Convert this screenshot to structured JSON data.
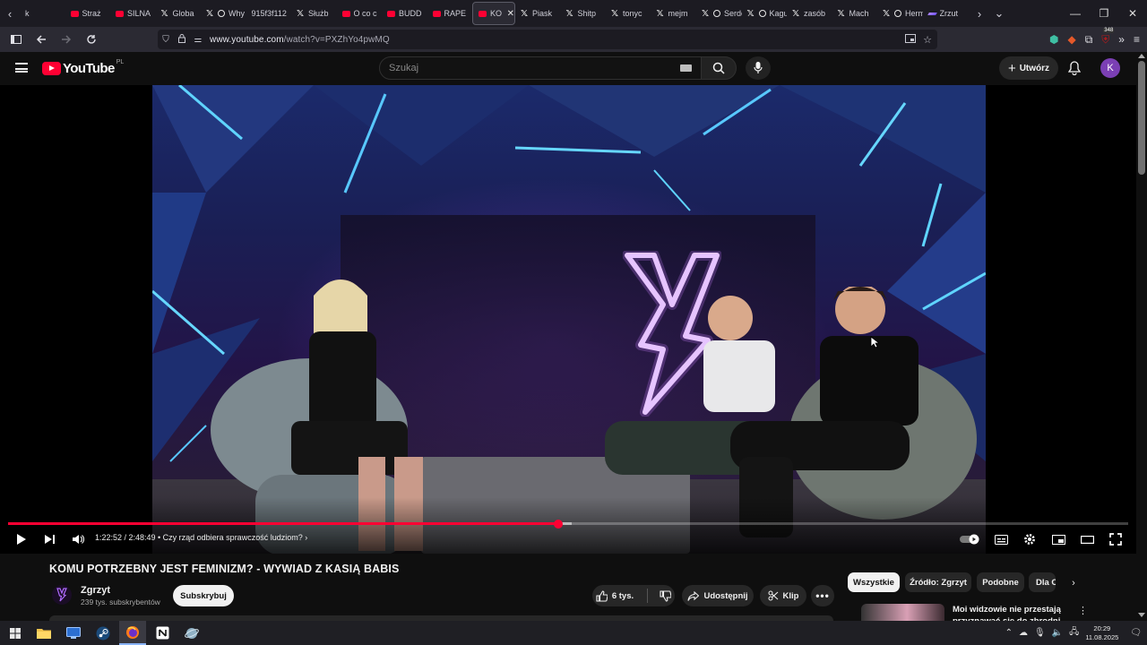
{
  "browser": {
    "tabs": [
      {
        "label": "k",
        "favicon": "plain"
      },
      {
        "label": "Straż",
        "favicon": "yt"
      },
      {
        "label": "SILNA",
        "favicon": "yt"
      },
      {
        "label": "Globa",
        "favicon": "x"
      },
      {
        "label": "Why y",
        "favicon": "x-pin"
      },
      {
        "label": "915f3f112",
        "favicon": "plain"
      },
      {
        "label": "Służb",
        "favicon": "x"
      },
      {
        "label": "O co c",
        "favicon": "yt"
      },
      {
        "label": "BUDD",
        "favicon": "yt"
      },
      {
        "label": "RAPE",
        "favicon": "yt"
      },
      {
        "label": "KO",
        "favicon": "yt",
        "active": true
      },
      {
        "label": "Piask",
        "favicon": "x"
      },
      {
        "label": "Shitp",
        "favicon": "x"
      },
      {
        "label": "tonyc",
        "favicon": "x"
      },
      {
        "label": "mejm",
        "favicon": "x"
      },
      {
        "label": "Serde",
        "favicon": "x-pin"
      },
      {
        "label": "Kaguy",
        "favicon": "x-pin"
      },
      {
        "label": "zasób",
        "favicon": "x"
      },
      {
        "label": "Mach",
        "favicon": "x"
      },
      {
        "label": "Herm",
        "favicon": "x-pin"
      },
      {
        "label": "Zrzut",
        "favicon": "pen"
      }
    ],
    "url_host": "www.youtube.com",
    "url_path": "/watch?v=PXZhYo4pwMQ",
    "extension_badge": "348"
  },
  "youtube": {
    "logo_text": "YouTube",
    "country_code": "PL",
    "search_placeholder": "Szukaj",
    "create_label": "Utwórz",
    "avatar_letter": "K"
  },
  "player": {
    "current_time": "1:22:52",
    "duration": "2:48:49",
    "time_display": "1:22:52 / 2:48:49",
    "chapter": "• Czy rząd odbiera sprawczość ludziom?",
    "progress": 0.491,
    "buffered": 0.503,
    "neon_color": "#e8d0ff",
    "accent": "#ff0033"
  },
  "video": {
    "title": "KOMU POTRZEBNY JEST FEMINIZM? - WYWIAD Z KASIĄ BABIS",
    "channel_name": "Zgrzyt",
    "subscribers": "239 tys. subskrybentów",
    "subscribe_label": "Subskrybuj",
    "likes": "6 tys.",
    "share_label": "Udostępnij",
    "clip_label": "Klip"
  },
  "sidebar": {
    "chips": [
      {
        "label": "Wszystkie",
        "active": true
      },
      {
        "label": "Źródło: Zgrzyt"
      },
      {
        "label": "Podobne"
      },
      {
        "label": "Dla C"
      }
    ],
    "recommendation_title": "Moi widzowie nie przestają przyznawać się do zbrodni"
  },
  "taskbar": {
    "time": "20:29",
    "date": "11.08.2025"
  }
}
